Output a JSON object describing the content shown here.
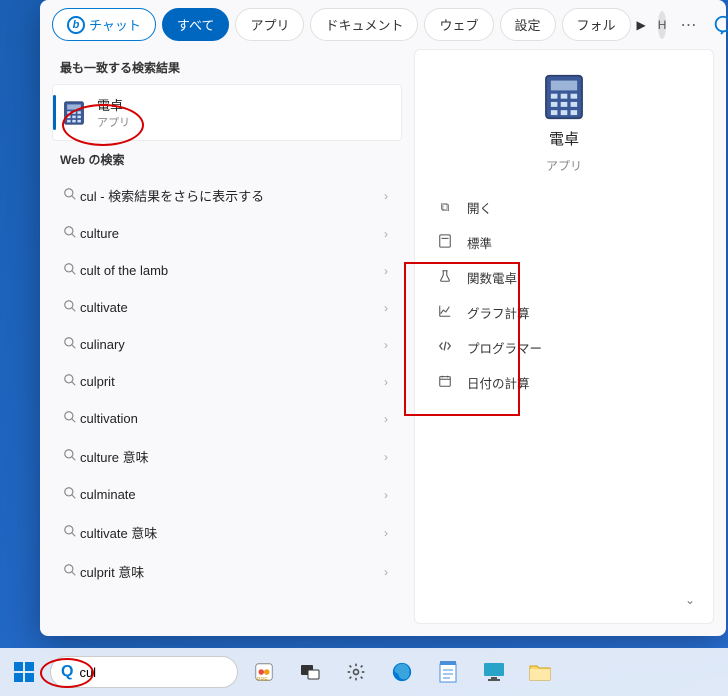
{
  "tabs": {
    "chat": "チャット",
    "all": "すべて",
    "apps": "アプリ",
    "documents": "ドキュメント",
    "web": "ウェブ",
    "settings": "設定",
    "folders": "フォル",
    "account_letter": "H"
  },
  "sections": {
    "best_match": "最も一致する検索結果",
    "web_search": "Web の検索"
  },
  "best_match": {
    "title": "電卓",
    "subtitle": "アプリ"
  },
  "web_results": [
    {
      "label": "cul - 検索結果をさらに表示する"
    },
    {
      "label": "culture"
    },
    {
      "label": "cult of the lamb"
    },
    {
      "label": "cultivate"
    },
    {
      "label": "culinary"
    },
    {
      "label": "culprit"
    },
    {
      "label": "cultivation"
    },
    {
      "label": "culture 意味"
    },
    {
      "label": "culminate"
    },
    {
      "label": "cultivate 意味"
    },
    {
      "label": "culprit 意味"
    }
  ],
  "preview": {
    "title": "電卓",
    "subtitle": "アプリ",
    "open": "開く",
    "actions": [
      {
        "icon": "calc",
        "label": "標準"
      },
      {
        "icon": "flask",
        "label": "関数電卓"
      },
      {
        "icon": "graph",
        "label": "グラフ計算"
      },
      {
        "icon": "code",
        "label": "プログラマー"
      },
      {
        "icon": "calendar",
        "label": "日付の計算"
      }
    ]
  },
  "taskbar": {
    "search_value": "cul",
    "search_placeholder": ""
  }
}
